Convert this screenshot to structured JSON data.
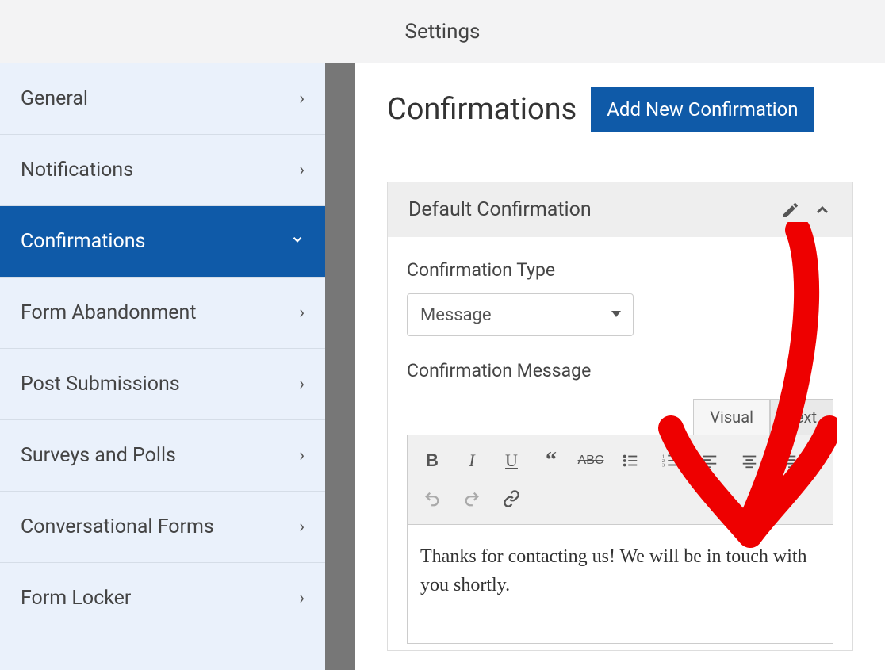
{
  "header": {
    "title": "Settings"
  },
  "sidebar": {
    "items": [
      {
        "label": "General",
        "active": false
      },
      {
        "label": "Notifications",
        "active": false
      },
      {
        "label": "Confirmations",
        "active": true
      },
      {
        "label": "Form Abandonment",
        "active": false
      },
      {
        "label": "Post Submissions",
        "active": false
      },
      {
        "label": "Surveys and Polls",
        "active": false
      },
      {
        "label": "Conversational Forms",
        "active": false
      },
      {
        "label": "Form Locker",
        "active": false
      }
    ]
  },
  "main": {
    "heading": "Confirmations",
    "addButtonLabel": "Add New Confirmation",
    "panel": {
      "title": "Default Confirmation",
      "typeLabel": "Confirmation Type",
      "typeValue": "Message",
      "messageLabel": "Confirmation Message",
      "editorTabs": {
        "visual": "Visual",
        "text": "Text"
      },
      "content": "Thanks for contacting us! We will be in touch with you shortly."
    }
  }
}
